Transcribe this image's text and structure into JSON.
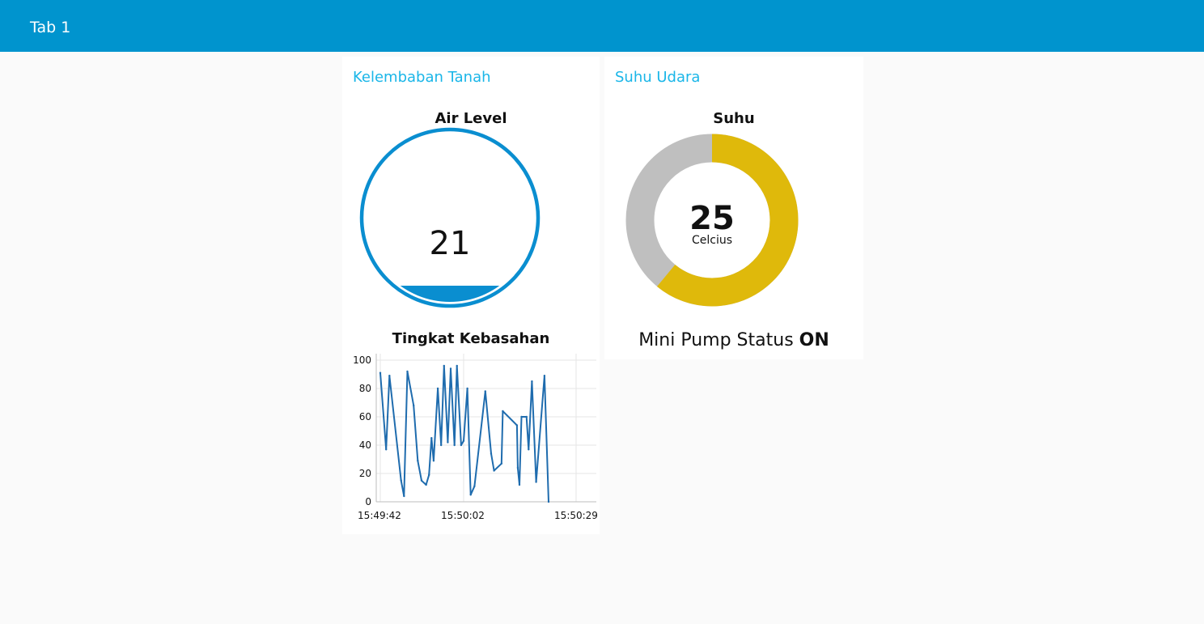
{
  "header": {
    "title": "Tab 1"
  },
  "groups": {
    "soil": {
      "title": "Kelembaban Tanah",
      "level_gauge": {
        "label": "Air Level",
        "value": "21",
        "fill_fraction": 0.21
      },
      "chart": {
        "label": "Tingkat Kebasahan",
        "y_ticks": [
          "100",
          "80",
          "60",
          "40",
          "20",
          "0"
        ],
        "x_ticks": [
          "15:49:42",
          "15:50:02",
          "15:50:29"
        ]
      }
    },
    "air": {
      "title": "Suhu Udara",
      "donut": {
        "label": "Suhu",
        "value": "25",
        "unit": "Celcius",
        "fill_fraction": 0.61
      },
      "pump": {
        "label": "Mini Pump Status",
        "value": "ON"
      }
    }
  },
  "colors": {
    "header": "#0094ce",
    "group_title": "#1ab6e8",
    "level_gauge": "#0a8ed0",
    "donut_fill": "#dfb90b",
    "donut_track": "#bfbfbf",
    "chart_line": "#1f6cae"
  },
  "chart_data": {
    "type": "line",
    "title": "Tingkat Kebasahan",
    "xlabel": "",
    "ylabel": "",
    "ylim": [
      0,
      100
    ],
    "xlim": [
      "15:49:42",
      "15:50:29"
    ],
    "grid": true,
    "x_ticks": [
      "15:49:42",
      "15:50:02",
      "15:50:29"
    ],
    "y_ticks": [
      0,
      20,
      40,
      60,
      80,
      100
    ],
    "series": [
      {
        "values": [
          {
            "t": 0.0,
            "v": 91
          },
          {
            "t": 1.4,
            "v": 37
          },
          {
            "t": 2.2,
            "v": 89
          },
          {
            "t": 5.0,
            "v": 15
          },
          {
            "t": 5.7,
            "v": 4
          },
          {
            "t": 6.5,
            "v": 92
          },
          {
            "t": 8.0,
            "v": 68
          },
          {
            "t": 9.0,
            "v": 29
          },
          {
            "t": 9.9,
            "v": 15
          },
          {
            "t": 11.0,
            "v": 12
          },
          {
            "t": 11.7,
            "v": 19
          },
          {
            "t": 12.3,
            "v": 45
          },
          {
            "t": 12.8,
            "v": 29
          },
          {
            "t": 13.8,
            "v": 80
          },
          {
            "t": 14.6,
            "v": 40
          },
          {
            "t": 15.3,
            "v": 96
          },
          {
            "t": 16.2,
            "v": 42
          },
          {
            "t": 16.9,
            "v": 94
          },
          {
            "t": 17.8,
            "v": 40
          },
          {
            "t": 18.4,
            "v": 96
          },
          {
            "t": 19.4,
            "v": 40
          },
          {
            "t": 20.0,
            "v": 43
          },
          {
            "t": 20.9,
            "v": 80
          },
          {
            "t": 21.7,
            "v": 5
          },
          {
            "t": 22.6,
            "v": 11
          },
          {
            "t": 25.2,
            "v": 78
          },
          {
            "t": 26.6,
            "v": 34
          },
          {
            "t": 27.3,
            "v": 22
          },
          {
            "t": 29.1,
            "v": 27
          },
          {
            "t": 29.4,
            "v": 64
          },
          {
            "t": 32.8,
            "v": 54
          },
          {
            "t": 33.0,
            "v": 24
          },
          {
            "t": 33.4,
            "v": 12
          },
          {
            "t": 33.9,
            "v": 60
          },
          {
            "t": 35.1,
            "v": 60
          },
          {
            "t": 35.6,
            "v": 37
          },
          {
            "t": 36.4,
            "v": 85
          },
          {
            "t": 37.4,
            "v": 14
          },
          {
            "t": 39.4,
            "v": 89
          },
          {
            "t": 40.4,
            "v": 0
          }
        ]
      }
    ]
  }
}
